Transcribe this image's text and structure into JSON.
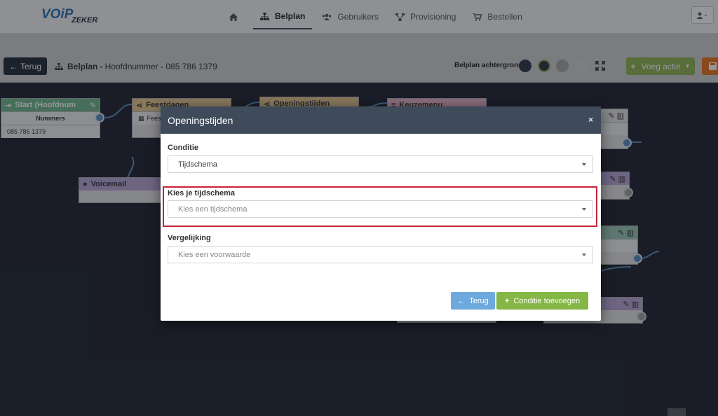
{
  "nav": {
    "logo_main": "VOIP",
    "logo_sub": "ZEKER",
    "items": [
      {
        "label": "",
        "icon": "home-icon"
      },
      {
        "label": "Belplan",
        "icon": "sitemap-icon"
      },
      {
        "label": "Gebruikers",
        "icon": "users-icon"
      },
      {
        "label": "Provisioning",
        "icon": "network-icon"
      },
      {
        "label": "Bestellen",
        "icon": "cart-icon"
      }
    ]
  },
  "toolbar": {
    "back_label": "Terug",
    "crumb_title": "Belplan -",
    "crumb_sub": "Hoofdnummer - 085 786 1379",
    "bg_label": "Belplan achtergrond",
    "bg_colors": [
      "#2d3848",
      "#2d3848",
      "#a6a6a6",
      "#d6d6d6"
    ],
    "add_label": "Voeg actie"
  },
  "canvas": {
    "start_title": "Start (Hoofdnum",
    "start_col": "Nummers",
    "start_number": "085 786 1379",
    "feestdagen_title": "Feestdagen",
    "feestdagen_row": "Feestda",
    "openingstijden_title": "Openingstijden",
    "keuzemenu_title": "Keuzemenu",
    "voicemail_title": "Voicemail"
  },
  "modal": {
    "title": "Openingstijden",
    "close": "×",
    "conditie_label": "Conditie",
    "conditie_value": "Tijdschema",
    "schema_label": "Kies je tijdschema",
    "schema_placeholder": "Kies een tijdschema",
    "vergelijking_label": "Vergelijking",
    "vergelijking_placeholder": "Kies een voorwaarde",
    "terug_label": "Terug",
    "add_label": "Conditie toevoegen"
  },
  "colors": {
    "modal_header": "#3f4a5b",
    "highlight": "#c6233a",
    "btn_blue": "#6ea9dd",
    "btn_green": "#84b745",
    "node_start": "#6fb98f",
    "node_feestdagen": "#e6c68f",
    "node_openingstijden": "#e6c68f",
    "node_keuzemenu": "#e7b3c6",
    "node_voicemail": "#b6a6d6"
  }
}
